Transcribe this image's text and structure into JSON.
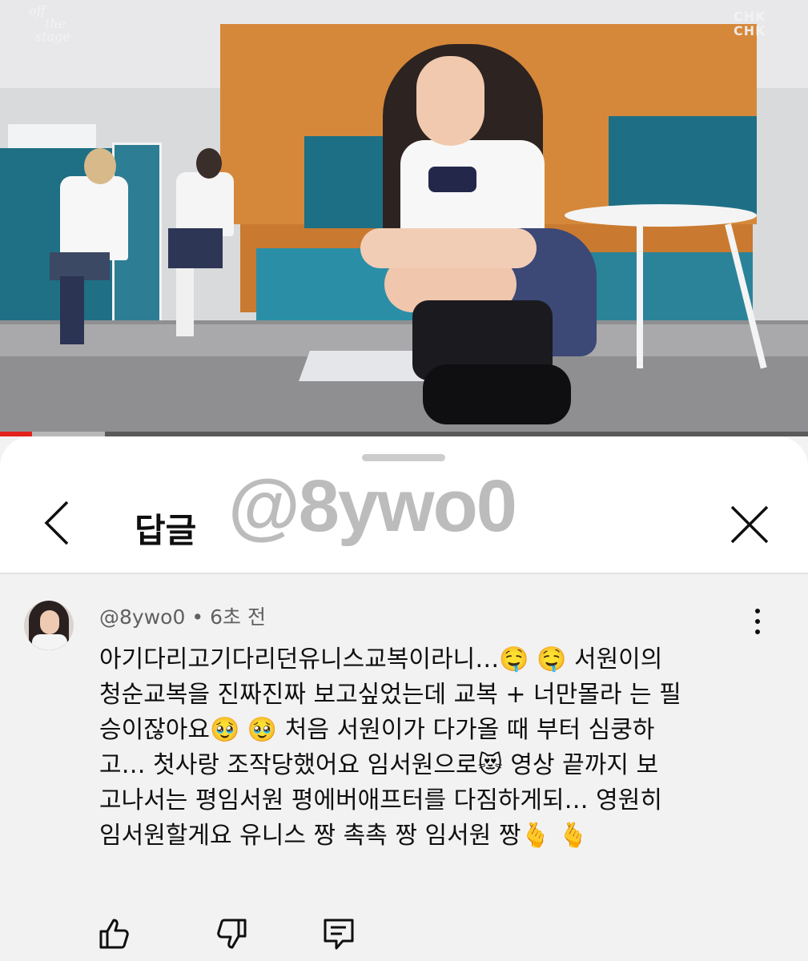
{
  "video": {
    "logo_left_lines": [
      "off",
      "the",
      "stage"
    ],
    "logo_right": "CHK CHK",
    "progress_fraction": 0.04,
    "buffered_fraction": 0.13,
    "accent_color": "#e3221b"
  },
  "sheet": {
    "title": "답글",
    "watermark": "@8ywo0",
    "back_icon": "chevron-left-icon",
    "close_icon": "close-icon"
  },
  "comment": {
    "author": "@8ywo0",
    "separator": "•",
    "time": "6초 전",
    "lines": [
      "아기다리고기다리던유니스교복이라니…🤤 🤤 서원이의",
      "청순교복을 진짜진짜 보고싶었는데 교복 + 너만몰라 는 필",
      "승이잖아요🥹 🥹 처음 서원이가 다가올 때 부터 심쿵하",
      "고… 첫사랑 조작당했어요 임서원으로😻 영상 끝까지 보",
      "고나서는 평임서원 평에버애프터를 다짐하게되… 영원히",
      "임서원할게요 유니스 짱 촉촉 짱 임서원 짱🫰 🫰"
    ],
    "actions": [
      "like-icon",
      "dislike-icon",
      "reply-icon"
    ]
  }
}
